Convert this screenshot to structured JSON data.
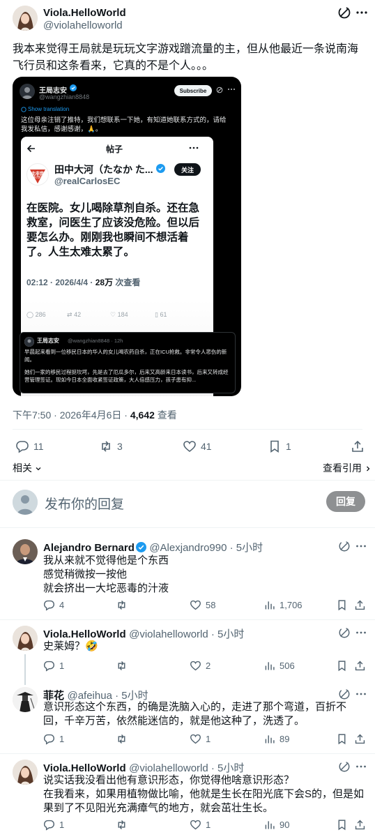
{
  "main_tweet": {
    "author_name": "Viola.HelloWorld",
    "author_handle": "@violahelloworld",
    "text": "我本来觉得王局就是玩玩文字游戏蹭流量的主，但从他最近一条说南海飞行员和这条看来，它真的不是个人。。。",
    "timestamp": "下午7:50 · 2026年4月6日 · ",
    "views_count": "4,642",
    "views_label": " 查看",
    "actions": {
      "replies": "11",
      "reposts": "3",
      "likes": "41",
      "bookmarks": "1"
    },
    "related_label": "相关",
    "quotes_label": "查看引用"
  },
  "embedded_image": {
    "author_name": "王局志安",
    "author_handle": "@wangzhian8848",
    "subscribe_label": "Subscribe",
    "show_translation": "Show translation",
    "tweet_text": "这位母亲注销了推特，我们想联系一下她，有知道她联系方式的，请给我发私信，感谢感谢，🙏。",
    "inner": {
      "header_title": "帖子",
      "name": "田中大河（たなか た...",
      "handle": "@realCarlosEC",
      "follow_label": "关注",
      "avatar_text": "此非我",
      "avatar_sub": "A7B0",
      "body": "在医院。女儿喝除草剂自杀。还在急救室，问医生了应该没危险。但以后要怎么办。刚刚我也瞬间不想活着了。人生太难太累了。",
      "meta_time": "02:12 · 2026/4/4 · ",
      "meta_views": "28万",
      "meta_views_label": " 次查看",
      "stats": {
        "replies": "286",
        "reposts": "42",
        "likes": "184",
        "bookmarks": "61"
      }
    },
    "quote": {
      "name": "王局志安",
      "handle": "@wangzhian8848 · 12h",
      "text1": "早晨起来看到一位移民日本的华人的女儿喝农药自杀，正在ICU抢救。非常令人悲伤的新闻。",
      "text2": "她们一家的移民过程挺坎坷，先是去了厄瓜多尔，后来又高龄来日本读书，后来又转成经营管理签证。现如今日本全面收紧签证政策，大人倍感压力，孩子患有抑..."
    }
  },
  "reply_box": {
    "placeholder": "发布你的回复",
    "button_label": "回复"
  },
  "replies": [
    {
      "name": "Alejandro Bernard",
      "handle": "@Alexjandro990 · 5小时",
      "verified": true,
      "text": "我从来就不觉得他是个东西\n感觉稍微按一按他\n就会挤出一大坨恶毒的汁液",
      "replies": "4",
      "reposts": "",
      "likes": "58",
      "views": "1,706"
    },
    {
      "name": "Viola.HelloWorld",
      "handle": "@violahelloworld · 5小时",
      "verified": false,
      "text": "史莱姆？🤣",
      "replies": "1",
      "reposts": "",
      "likes": "2",
      "views": "506"
    },
    {
      "name": "菲花",
      "handle": "@afeihua · 5小时",
      "verified": false,
      "text": "意识形态这个东西，的确是洗脑入心的，走进了那个弯道，百折不回，千辛万苦，依然能迷信的，就是他这种了，洗透了。",
      "replies": "1",
      "reposts": "",
      "likes": "1",
      "views": "89"
    },
    {
      "name": "Viola.HelloWorld",
      "handle": "@violahelloworld · 5小时",
      "verified": false,
      "text": "说实话我没看出他有意识形态，你觉得他啥意识形态？\n在我看来，如果用植物做比喻，他就是生长在阳光底下会S的，但是如果到了不见阳光充满瘴气的地方，就会茁壮生长。",
      "replies": "1",
      "reposts": "",
      "likes": "1",
      "views": "90"
    }
  ],
  "colors": {
    "accent": "#1d9bf0",
    "muted": "#536471",
    "text": "#0f1419",
    "divider": "#eff3f4"
  }
}
